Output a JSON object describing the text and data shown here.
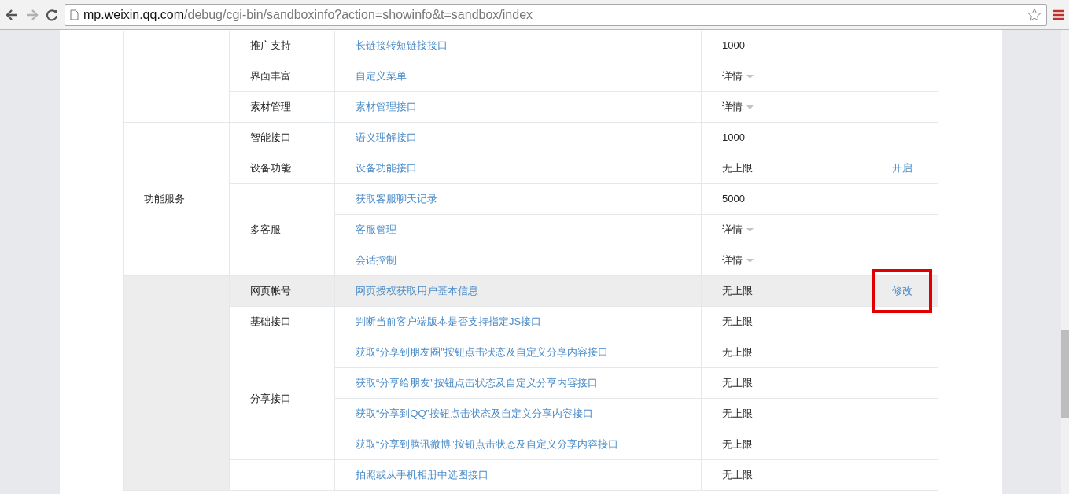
{
  "browser": {
    "url": {
      "host": "mp.weixin.qq.com",
      "path": "/debug/cgi-bin/sandboxinfo?action=showinfo&t=sandbox/index"
    }
  },
  "table": {
    "groups": [
      {
        "shaded": false,
        "subgroups": [
          {
            "name": "推广支持",
            "rows": [
              {
                "api": "长链接转短链接接口",
                "limit": {
                  "kind": "text",
                  "text": "1000"
                },
                "highlighted": false
              }
            ]
          },
          {
            "name": "界面丰富",
            "rows": [
              {
                "api": "自定义菜单",
                "limit": {
                  "kind": "dropdown",
                  "text": "详情"
                },
                "highlighted": false
              }
            ]
          },
          {
            "name": "素材管理",
            "rows": [
              {
                "api": "素材管理接口",
                "limit": {
                  "kind": "dropdown",
                  "text": "详情"
                },
                "highlighted": false
              }
            ]
          }
        ]
      },
      {
        "category": "功能服务",
        "shaded": false,
        "subgroups": [
          {
            "name": "智能接口",
            "rows": [
              {
                "api": "语义理解接口",
                "limit": {
                  "kind": "text",
                  "text": "1000"
                },
                "highlighted": false
              }
            ]
          },
          {
            "name": "设备功能",
            "rows": [
              {
                "api": "设备功能接口",
                "limit": {
                  "kind": "text",
                  "text": "无上限"
                },
                "action": {
                  "text": "开启",
                  "outlined": false
                },
                "highlighted": false
              }
            ]
          },
          {
            "name": "多客服",
            "rows": [
              {
                "api": "获取客服聊天记录",
                "limit": {
                  "kind": "text",
                  "text": "5000"
                },
                "highlighted": false
              },
              {
                "api": "客服管理",
                "limit": {
                  "kind": "dropdown",
                  "text": "详情"
                },
                "highlighted": false
              },
              {
                "api": "会话控制",
                "limit": {
                  "kind": "dropdown",
                  "text": "详情"
                },
                "highlighted": false
              }
            ]
          }
        ]
      },
      {
        "shaded": true,
        "subgroups": [
          {
            "name": "网页帐号",
            "rows": [
              {
                "api": "网页授权获取用户基本信息",
                "limit": {
                  "kind": "text",
                  "text": "无上限"
                },
                "action": {
                  "text": "修改",
                  "outlined": true
                },
                "highlighted": true
              }
            ]
          },
          {
            "name": "基础接口",
            "rows": [
              {
                "api": "判断当前客户端版本是否支持指定JS接口",
                "limit": {
                  "kind": "text",
                  "text": "无上限"
                },
                "highlighted": false
              }
            ]
          },
          {
            "name": "分享接口",
            "rows": [
              {
                "api": "获取“分享到朋友圈”按钮点击状态及自定义分享内容接口",
                "limit": {
                  "kind": "text",
                  "text": "无上限"
                },
                "highlighted": false
              },
              {
                "api": "获取“分享给朋友”按钮点击状态及自定义分享内容接口",
                "limit": {
                  "kind": "text",
                  "text": "无上限"
                },
                "highlighted": false
              },
              {
                "api": "获取“分享到QQ”按钮点击状态及自定义分享内容接口",
                "limit": {
                  "kind": "text",
                  "text": "无上限"
                },
                "highlighted": false
              },
              {
                "api": "获取“分享到腾讯微博”按钮点击状态及自定义分享内容接口",
                "limit": {
                  "kind": "text",
                  "text": "无上限"
                },
                "highlighted": false
              }
            ]
          },
          {
            "rows": [
              {
                "api": "拍照或从手机相册中选图接口",
                "limit": {
                  "kind": "text",
                  "text": "无上限"
                },
                "highlighted": false
              }
            ]
          }
        ]
      }
    ]
  }
}
